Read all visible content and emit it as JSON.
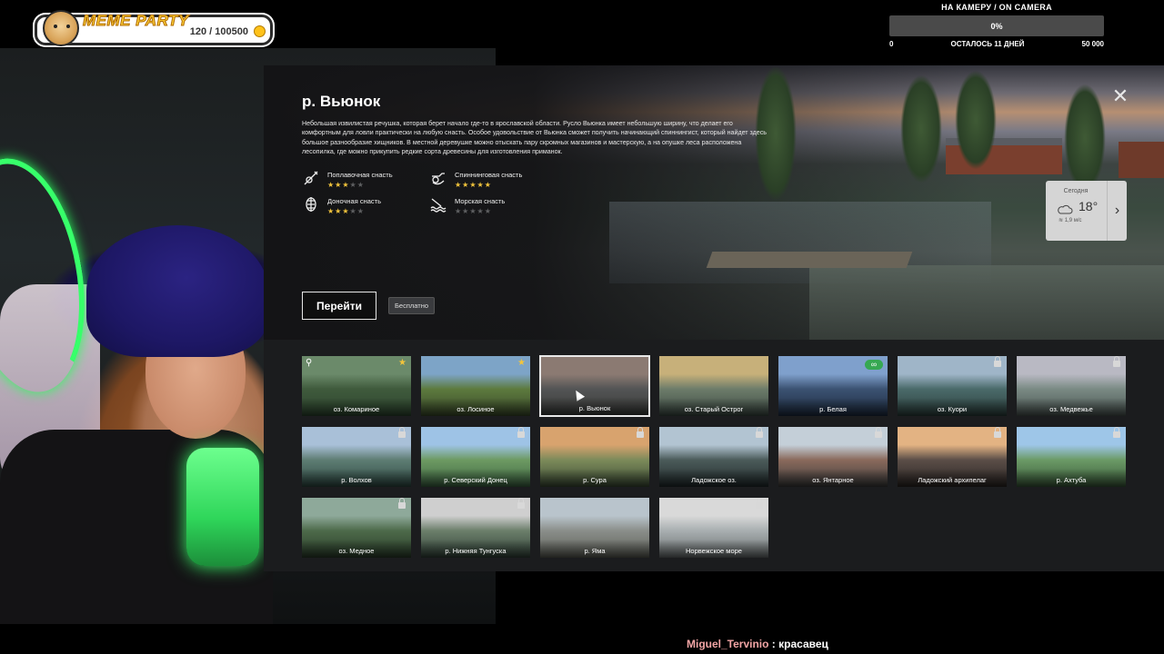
{
  "stream": {
    "badge_title": "MEME PARTY",
    "badge_count": "120 / 100500",
    "camera_goal": {
      "title": "НА КАМЕРУ / ON CAMERA",
      "percent": "0%",
      "progress": 0,
      "min": "0",
      "remaining": "ОСТАЛОСЬ 11 ДНЕЙ",
      "max": "50 000"
    },
    "chat": {
      "nick": "Miguel_Tervinio",
      "sep": " : ",
      "msg": "красавец"
    }
  },
  "location": {
    "title": "р. Вьюнок",
    "description": "Небольшая извилистая речушка, которая берет начало где-то в ярославской области. Русло Вьюнка имеет небольшую ширину, что делает его комфортным для ловли практически на любую снасть. Особое удовольствие от Вьюнка сможет получить начинающий спиннингист, который найдет здесь большое разнообразие хищников. В местной деревушке можно отыскать пару скромных магазинов и мастерскую, а на опушке леса расположена лесопилка, где можно прикупить редкие сорта древесины для изготовления приманок.",
    "gear": [
      {
        "label": "Поплавочная снасть",
        "icon": "float-rod-icon",
        "rating": 2.5
      },
      {
        "label": "Спиннинговая снасть",
        "icon": "spinning-rod-icon",
        "rating": 5
      },
      {
        "label": "Доночная снасть",
        "icon": "bottom-rod-icon",
        "rating": 2.5
      },
      {
        "label": "Морская снасть",
        "icon": "sea-rod-icon",
        "rating": 0
      }
    ],
    "go_label": "Перейти",
    "price_label": "Бесплатно",
    "close_icon": "close-icon",
    "weather": {
      "day": "Сегодня",
      "temp": "18°",
      "wind": "1,9 м/с",
      "icon": "cloud-icon"
    }
  },
  "locations": [
    {
      "name": "оз. Комариное",
      "badge": "star",
      "pin": true,
      "colors": [
        "#6b8a6a",
        "#3f5a3c",
        "#2e4630"
      ]
    },
    {
      "name": "оз. Лосиное",
      "badge": "star",
      "colors": [
        "#7da4c7",
        "#5d7a3e",
        "#3a4a2a"
      ]
    },
    {
      "name": "р. Вьюнок",
      "badge": "",
      "selected": true,
      "colors": [
        "#8b7a72",
        "#535455",
        "#3b3d3a"
      ]
    },
    {
      "name": "оз. Старый Острог",
      "badge": "",
      "colors": [
        "#c7b07a",
        "#6d7c6a",
        "#3c4a44"
      ]
    },
    {
      "name": "р. Белая",
      "badge": "infinity",
      "colors": [
        "#7fa0cc",
        "#3b5272",
        "#1e2c40"
      ]
    },
    {
      "name": "оз. Куори",
      "badge": "lock",
      "colors": [
        "#9fb5c8",
        "#4a6a6a",
        "#2c3f3c"
      ]
    },
    {
      "name": "оз. Медвежье",
      "badge": "lock",
      "colors": [
        "#b9b9c3",
        "#7a8a84",
        "#4a5552"
      ]
    },
    {
      "name": "р. Волхов",
      "badge": "lock",
      "colors": [
        "#a9c0d8",
        "#5e7d73",
        "#2f4a44"
      ]
    },
    {
      "name": "р. Северский Донец",
      "badge": "lock",
      "colors": [
        "#9ec3e6",
        "#6d9a62",
        "#3e6644"
      ]
    },
    {
      "name": "р. Сура",
      "badge": "lock",
      "colors": [
        "#d8a36e",
        "#7c8a5a",
        "#3d4d36"
      ]
    },
    {
      "name": "Ладожское оз.",
      "badge": "lock",
      "colors": [
        "#b2c4d2",
        "#4b5b5a",
        "#222b2c"
      ]
    },
    {
      "name": "оз. Янтарное",
      "badge": "lock",
      "colors": [
        "#c4cfd8",
        "#8a6a5c",
        "#3c3c3c"
      ]
    },
    {
      "name": "Ладожский архипелаг",
      "badge": "lock",
      "colors": [
        "#e3b383",
        "#5b4e48",
        "#2a2523"
      ]
    },
    {
      "name": "р. Ахтуба",
      "badge": "lock",
      "colors": [
        "#9ec6e8",
        "#6b9a66",
        "#3a5a3a"
      ]
    },
    {
      "name": "оз. Медное",
      "badge": "lock",
      "colors": [
        "#8ea99a",
        "#4d6a4a",
        "#2a3d2a"
      ]
    },
    {
      "name": "р. Нижняя Тунгуска",
      "badge": "lock",
      "colors": [
        "#cfcfcf",
        "#6b7e6a",
        "#33443a"
      ]
    },
    {
      "name": "р. Яма",
      "badge": "",
      "colors": [
        "#b9c4cc",
        "#8a8e8a",
        "#5e6058"
      ]
    },
    {
      "name": "Норвежское море",
      "badge": "lock",
      "colors": [
        "#d9d9d9",
        "#a8aeb0",
        "#6a7070"
      ]
    }
  ]
}
